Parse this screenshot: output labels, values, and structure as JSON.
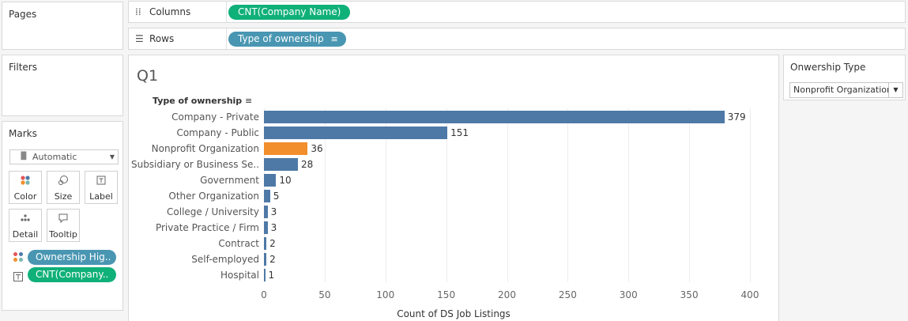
{
  "cards": {
    "pages": "Pages",
    "filters": "Filters",
    "marks": "Marks"
  },
  "columns_shelf": {
    "label": "Columns",
    "pill": "CNT(Company Name)"
  },
  "rows_shelf": {
    "label": "Rows",
    "pill": "Type of ownership"
  },
  "marks": {
    "mark_type": "Automatic",
    "buttons": [
      "Color",
      "Size",
      "Label",
      "Detail",
      "Tooltip"
    ],
    "pills": [
      "Ownership Hig..",
      "CNT(Company.."
    ]
  },
  "parameter": {
    "title": "Onwership Type",
    "selected": "Nonprofit Organization"
  },
  "colors": {
    "bar": "#4e79a7",
    "highlight": "#f28e2b",
    "pill_green": "#10b079",
    "pill_blue": "#4996b2"
  },
  "chart_data": {
    "type": "bar",
    "orientation": "horizontal",
    "title": "Q1",
    "row_header": "Type of ownership",
    "xlabel": "Count of DS Job Listings",
    "categories": [
      "Company - Private",
      "Company - Public",
      "Nonprofit Organization",
      "Subsidiary or Business Se..",
      "Government",
      "Other Organization",
      "College / University",
      "Private Practice / Firm",
      "Contract",
      "Self-employed",
      "Hospital"
    ],
    "values": [
      379,
      151,
      36,
      28,
      10,
      5,
      3,
      3,
      2,
      2,
      1
    ],
    "highlighted": "Nonprofit Organization",
    "xlim": [
      0,
      400
    ],
    "xticks": [
      0,
      50,
      100,
      150,
      200,
      250,
      300,
      350,
      400
    ],
    "grid": true,
    "sorted": "descending"
  }
}
